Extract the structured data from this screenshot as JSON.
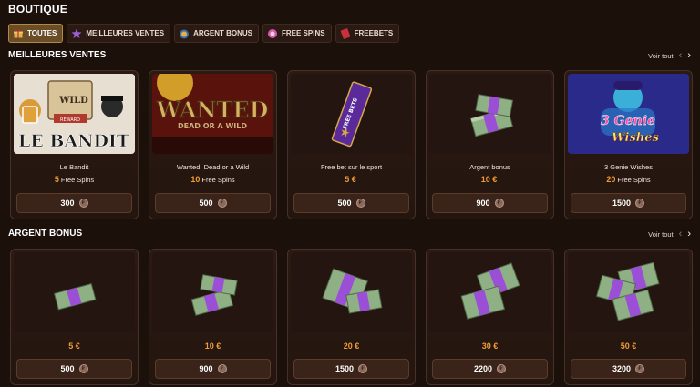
{
  "page": {
    "title": "BOUTIQUE"
  },
  "tabs": [
    {
      "label": "TOUTES",
      "icon": "gift-icon",
      "active": true
    },
    {
      "label": "MEILLEURES VENTES",
      "icon": "star-icon",
      "active": false
    },
    {
      "label": "ARGENT BONUS",
      "icon": "money-bag-icon",
      "active": false
    },
    {
      "label": "FREE SPINS",
      "icon": "spins-icon",
      "active": false
    },
    {
      "label": "FREEBETS",
      "icon": "ticket-icon",
      "active": false
    }
  ],
  "bestsellers": {
    "title": "MEILLEURES VENTES",
    "see_all": "Voir tout",
    "cards": [
      {
        "name": "Le Bandit",
        "reward_value": "5",
        "reward_unit": "Free Spins",
        "price": "300",
        "image": "le-bandit-game-art",
        "image_text": "LE BANDIT"
      },
      {
        "name": "Wanted: Dead or a Wild",
        "reward_value": "10",
        "reward_unit": "Free Spins",
        "price": "500",
        "image": "wanted-game-art",
        "image_text": "WANTED",
        "image_subtext": "DEAD OR A WILD"
      },
      {
        "name": "Free bet sur le sport",
        "reward_value": "5 €",
        "reward_unit": "",
        "price": "500",
        "image": "free-bets-ticket",
        "image_text": "FREE BETS"
      },
      {
        "name": "Argent bonus",
        "reward_value": "10 €",
        "reward_unit": "",
        "price": "900",
        "image": "cash-stack"
      },
      {
        "name": "3 Genie Wishes",
        "reward_value": "20",
        "reward_unit": "Free Spins",
        "price": "1500",
        "image": "genie-game-art",
        "image_text": "3 Genie",
        "image_subtext": "Wishes"
      }
    ]
  },
  "bonus": {
    "title": "ARGENT BONUS",
    "see_all": "Voir tout",
    "cards": [
      {
        "amount": "5 €",
        "price": "500",
        "image": "cash-stack-small"
      },
      {
        "amount": "10 €",
        "price": "900",
        "image": "cash-stack-medium"
      },
      {
        "amount": "20 €",
        "price": "1500",
        "image": "cash-stack-large"
      },
      {
        "amount": "30 €",
        "price": "2200",
        "image": "cash-stack-larger"
      },
      {
        "amount": "50 €",
        "price": "3200",
        "image": "cash-stack-largest"
      }
    ]
  },
  "colors": {
    "accent_orange": "#ef9c37",
    "background": "#1c100b",
    "card": "#2b1a12",
    "active_tab": "#6a4d26",
    "bill_purple": "#9b4fd6",
    "bill_green": "#8fb084"
  }
}
